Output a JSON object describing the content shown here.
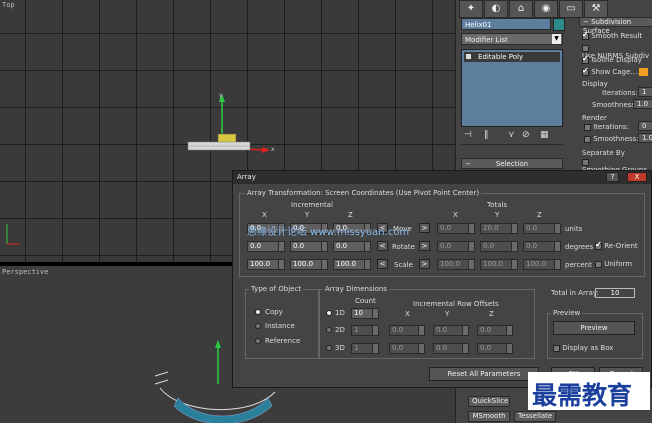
{
  "viewports": {
    "top_label": "Top",
    "persp_label": "Perspective",
    "axis_x": "x",
    "axis_y": "y"
  },
  "panel": {
    "object_name": "Helix01",
    "modifier_list": "Modifier List",
    "stack_item": "Editable Poly",
    "selection_rollout": "Selection",
    "subdivision_surface": "Subdivision Surface",
    "smooth_result": "Smooth Result",
    "use_nurms": "Use NURMS Subdiv",
    "isoline_display": "Isoline Display",
    "show_cage": "Show Cage......",
    "display_label": "Display",
    "iterations_label": "Iterations:",
    "display_iterations": "1",
    "smoothness_label": "Smoothness:",
    "display_smoothness": "1.0",
    "render_label": "Render",
    "render_iterations": "0",
    "render_smoothness": "1.0",
    "separate_by": "Separate By",
    "smoothing_groups": "Smoothing Groups",
    "quick_slice": "QuickSlice",
    "msmooth": "MSmooth",
    "tessellate": "Tessellate"
  },
  "dialog": {
    "title": "Array",
    "transform_group": "Array Transformation: Screen Coordinates (Use Pivot Point Center)",
    "incremental": "Incremental",
    "totals": "Totals",
    "col_x": "X",
    "col_y": "Y",
    "col_z": "Z",
    "move_label": "Move",
    "rotate_label": "Rotate",
    "scale_label": "Scale",
    "units": "units",
    "degrees": "degrees",
    "percent": "percent",
    "re_orient": "Re-Orient",
    "uniform": "Uniform",
    "inc_move": [
      "0.0",
      "0.0",
      "0.0"
    ],
    "inc_rotate": [
      "0.0",
      "0.0",
      "0.0"
    ],
    "inc_scale": [
      "100.0",
      "100.0",
      "100.0"
    ],
    "tot_move": [
      "0.0",
      "20.0",
      "0.0"
    ],
    "tot_rotate": [
      "0.0",
      "0.0",
      "0.0"
    ],
    "tot_scale": [
      "100.0",
      "100.0",
      "100.0"
    ],
    "type_of_object": "Type of Object",
    "copy": "Copy",
    "instance": "Instance",
    "reference": "Reference",
    "array_dimensions": "Array Dimensions",
    "count": "Count",
    "dim_1d": "1D",
    "dim_2d": "2D",
    "dim_3d": "3D",
    "count_1d": "10",
    "count_2d": "1",
    "count_3d": "1",
    "row_offsets": "Incremental Row Offsets",
    "offsets_2d": [
      "0.0",
      "0.0",
      "0.0"
    ],
    "offsets_3d": [
      "0.0",
      "0.0",
      "0.0"
    ],
    "total_in_array_label": "Total in Array:",
    "total_in_array": "10",
    "preview_group": "Preview",
    "preview_button": "Preview",
    "display_as_box": "Display as Box",
    "reset_all": "Reset All Parameters",
    "ok": "OK",
    "cancel": "Cancel",
    "help_button": "?",
    "close_button": "X"
  },
  "watermarks": {
    "center": "思缘设计论坛 www.missyuan.com",
    "corner": "最需教育"
  },
  "colors": {
    "accent": "#5e7e9e",
    "close": "#c0392b",
    "swatch": "#f0a020",
    "corner_watermark": "#1a3f9c"
  }
}
